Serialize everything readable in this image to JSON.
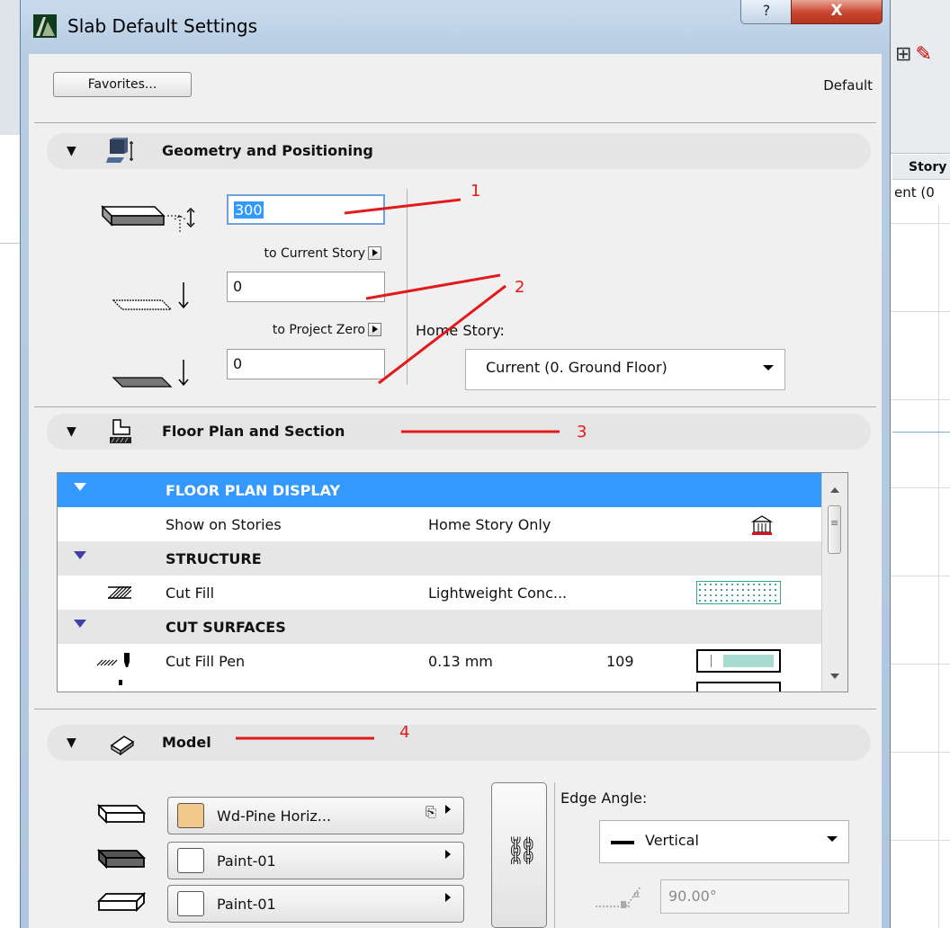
{
  "background": {
    "story_header": "Story",
    "story_cell": "ent (0"
  },
  "dialog": {
    "title": "Slab Default Settings",
    "help_label": "?",
    "close_label": "X",
    "favorites_label": "Favorites...",
    "favorites_status": "Default"
  },
  "geometry": {
    "title": "Geometry and Positioning",
    "thickness_value": "300",
    "to_current_story_label": "to Current Story",
    "offset_story_value": "0",
    "to_project_zero_label": "to Project Zero",
    "offset_zero_value": "0",
    "home_story_label": "Home Story:",
    "home_story_value": "Current (0. Ground Floor)"
  },
  "floorplan": {
    "title": "Floor Plan and Section",
    "rows": [
      {
        "name": "FLOOR PLAN DISPLAY"
      },
      {
        "name": "Show on Stories",
        "value": "Home Story Only"
      },
      {
        "name": "STRUCTURE"
      },
      {
        "name": "Cut Fill",
        "value": "Lightweight Conc..."
      },
      {
        "name": "CUT SURFACES"
      },
      {
        "name": "Cut Fill Pen",
        "value": "0.13 mm",
        "number": "109"
      }
    ]
  },
  "model": {
    "title": "Model",
    "materials": [
      {
        "name": "Wd-Pine Horiz...",
        "color": "#f2c98b"
      },
      {
        "name": "Paint-01",
        "color": "#ffffff"
      },
      {
        "name": "Paint-01",
        "color": "#ffffff"
      }
    ],
    "edge_angle_label": "Edge Angle:",
    "edge_angle_value": "Vertical",
    "angle_value": "90.00°"
  },
  "annotations": [
    "1",
    "2",
    "3",
    "4"
  ],
  "colors": {
    "selection": "#3399ff",
    "annotation": "#e31a1c",
    "group_triangle": "#3f3fa8"
  }
}
